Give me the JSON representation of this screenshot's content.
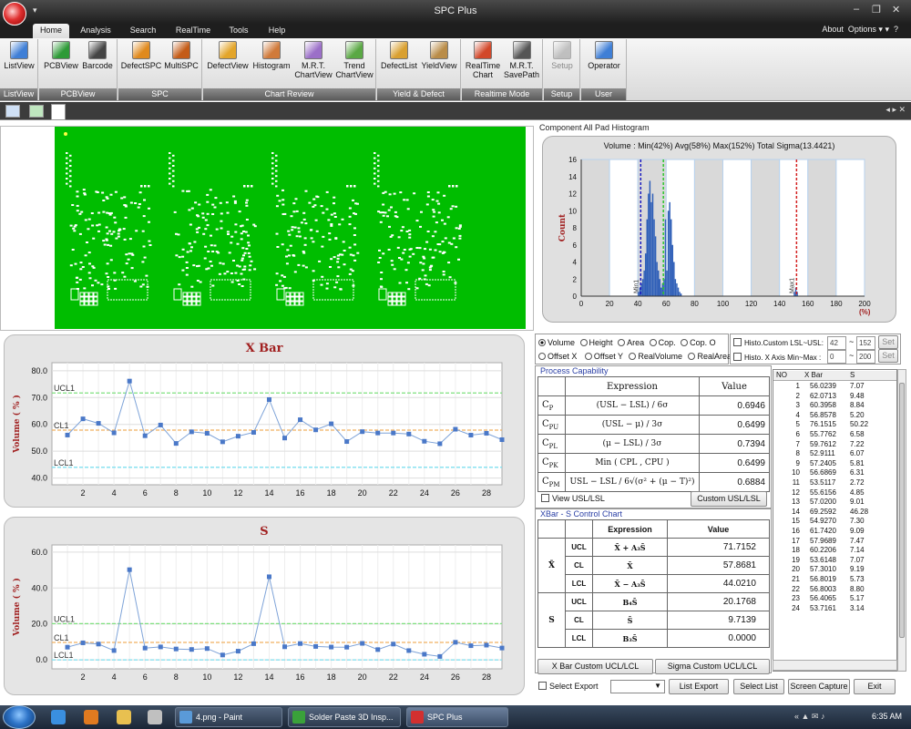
{
  "window": {
    "title": "SPC Plus",
    "controls": [
      "‒",
      "❐",
      "✕"
    ]
  },
  "ribbon_tabs": [
    {
      "label": "Home",
      "active": true
    },
    {
      "label": "Analysis"
    },
    {
      "label": "Search"
    },
    {
      "label": "RealTime"
    },
    {
      "label": "Tools"
    },
    {
      "label": "Help"
    }
  ],
  "top_right": {
    "about": "About",
    "options": "Options",
    "options_arrow": "▾ ▾",
    "help": "?"
  },
  "ribbon_groups": [
    {
      "label": "ListView",
      "buttons": [
        {
          "label": "ListView",
          "color": "#3f7fd6"
        }
      ]
    },
    {
      "label": "PCBView",
      "buttons": [
        {
          "label": "PCBView",
          "color": "#2e9a37"
        },
        {
          "label": "Barcode",
          "color": "#444444"
        }
      ]
    },
    {
      "label": "SPC",
      "buttons": [
        {
          "label": "DefectSPC",
          "color": "#e08a1e"
        },
        {
          "label": "MultiSPC",
          "color": "#c45c18"
        }
      ]
    },
    {
      "label": "Chart Review",
      "buttons": [
        {
          "label": "DefectView",
          "color": "#e3a52a"
        },
        {
          "label": "Histogram",
          "color": "#d07a3a"
        },
        {
          "label": "M.R.T. ChartView",
          "color": "#9b6fc8"
        },
        {
          "label": "Trend ChartView",
          "color": "#5aa844"
        }
      ]
    },
    {
      "label": "Yield & Defect",
      "buttons": [
        {
          "label": "DefectList",
          "color": "#d9a030"
        },
        {
          "label": "YieldView",
          "color": "#b98c48"
        }
      ]
    },
    {
      "label": "Realtime Mode",
      "buttons": [
        {
          "label": "RealTime Chart",
          "color": "#d2482a"
        },
        {
          "label": "M.R.T. SavePath",
          "color": "#555555"
        }
      ]
    },
    {
      "label": "Setup",
      "buttons": [
        {
          "label": "Setup",
          "color": "#999999",
          "disabled": true
        }
      ]
    },
    {
      "label": "User",
      "buttons": [
        {
          "label": "Operator",
          "color": "#3f7fd6"
        }
      ]
    }
  ],
  "doc_nav": "◂ ▸ ✕",
  "histogram": {
    "frame_title": "Component All Pad Histogram",
    "summary": "Volume : Min(42%) Avg(58%) Max(152%)  Total Sigma(13.4421)",
    "ylabel": "Count",
    "xunit": "(%)",
    "markers": {
      "min": "Min1",
      "max": "Max1"
    }
  },
  "chart_data": [
    {
      "type": "bar",
      "title": "",
      "xlabel": "(%)",
      "ylabel": "Count",
      "xlim": [
        0,
        200
      ],
      "ylim": [
        0,
        16
      ],
      "xticks": [
        0,
        20,
        40,
        60,
        80,
        100,
        120,
        140,
        160,
        180,
        200
      ],
      "yticks": [
        0,
        2,
        4,
        6,
        8,
        10,
        12,
        14,
        16
      ],
      "x": [
        40,
        41,
        42,
        43,
        44,
        45,
        46,
        47,
        48,
        49,
        50,
        51,
        52,
        53,
        54,
        55,
        56,
        57,
        58,
        59,
        60,
        61,
        62,
        63,
        64,
        65,
        66,
        67,
        68,
        69,
        70,
        150,
        151,
        152
      ],
      "values": [
        0.5,
        1,
        1.5,
        2,
        3,
        5,
        9,
        12,
        13.5,
        11,
        12,
        9,
        7,
        4,
        3,
        2,
        1,
        1.5,
        2,
        9,
        3,
        10,
        11,
        9,
        6,
        4,
        2,
        1.5,
        1,
        0.5,
        0.3,
        0.5,
        1,
        0.5
      ],
      "lines": [
        {
          "name": "Min1",
          "x": 42,
          "color": "#1a1ac0"
        },
        {
          "name": "Avg",
          "x": 58,
          "color": "#2ec72e"
        },
        {
          "name": "Max1",
          "x": 152,
          "color": "#d42020"
        }
      ]
    },
    {
      "type": "line",
      "title": "X Bar",
      "ylabel": "Volume ( % )",
      "xlim": [
        0,
        29
      ],
      "ylim": [
        37.5,
        83
      ],
      "yticks": [
        40.0,
        50.0,
        60.0,
        70.0,
        80.0
      ],
      "ytick_labels": [
        "40.0",
        "50.0",
        "60.0",
        "70.0",
        "80.0"
      ],
      "xticks": [
        2,
        4,
        6,
        8,
        10,
        12,
        14,
        16,
        18,
        20,
        22,
        24,
        26,
        28
      ],
      "x": [
        1,
        2,
        3,
        4,
        5,
        6,
        7,
        8,
        9,
        10,
        11,
        12,
        13,
        14,
        15,
        16,
        17,
        18,
        19,
        20,
        21,
        22,
        23,
        24,
        25,
        26,
        27,
        28,
        29
      ],
      "values": [
        56.0239,
        62.0713,
        60.3958,
        56.8578,
        76.1515,
        55.7762,
        59.7612,
        52.9111,
        57.2405,
        56.6869,
        53.5117,
        55.6156,
        57.02,
        69.2592,
        54.927,
        61.742,
        57.9689,
        60.2206,
        53.6148,
        57.301,
        56.8019,
        56.8003,
        56.4065,
        53.7161,
        52.8,
        58.2,
        56.0,
        56.7,
        54.3
      ],
      "limits": [
        {
          "name": "UCL1",
          "value": 71.7152,
          "color": "#7ee07e"
        },
        {
          "name": "CL1",
          "value": 57.8681,
          "color": "#f0b060"
        },
        {
          "name": "LCL1",
          "value": 44.021,
          "color": "#7fdfef"
        }
      ],
      "limit_labels": {
        "ucl": "UCL1",
        "cl": "CL1",
        "lcl": "LCL1"
      }
    },
    {
      "type": "line",
      "title": "S",
      "ylabel": "Volume ( % )",
      "xlim": [
        0,
        29
      ],
      "ylim": [
        -5,
        64
      ],
      "yticks": [
        0,
        20,
        40,
        60
      ],
      "ytick_labels": [
        "0.0",
        "20.0",
        "40.0",
        "60.0"
      ],
      "xticks": [
        2,
        4,
        6,
        8,
        10,
        12,
        14,
        16,
        18,
        20,
        22,
        24,
        26,
        28
      ],
      "x": [
        1,
        2,
        3,
        4,
        5,
        6,
        7,
        8,
        9,
        10,
        11,
        12,
        13,
        14,
        15,
        16,
        17,
        18,
        19,
        20,
        21,
        22,
        23,
        24,
        25,
        26,
        27,
        28,
        29
      ],
      "values": [
        7.07,
        9.48,
        8.8,
        5.2,
        50.22,
        6.58,
        7.22,
        6.07,
        5.81,
        6.31,
        2.72,
        4.85,
        9.01,
        46.28,
        7.3,
        9.09,
        7.47,
        7.14,
        7.07,
        9.19,
        5.73,
        8.8,
        5.17,
        3.14,
        1.9,
        9.8,
        7.9,
        8.2,
        6.6
      ],
      "limits": [
        {
          "name": "UCL1",
          "value": 20.1768,
          "color": "#7ee07e"
        },
        {
          "name": "CL1",
          "value": 9.7139,
          "color": "#f0b060"
        },
        {
          "name": "LCL1",
          "value": 0.0,
          "color": "#7fdfef"
        }
      ],
      "limit_labels": {
        "ucl": "UCL1",
        "cl": "CL1",
        "lcl": "LCL1"
      }
    }
  ],
  "measure_options": {
    "row1": [
      {
        "label": "Volume",
        "checked": true
      },
      {
        "label": "Height"
      },
      {
        "label": "Area"
      },
      {
        "label": "Cop."
      },
      {
        "label": "Cop. O"
      }
    ],
    "row2": [
      {
        "label": "Offset X"
      },
      {
        "label": "Offset Y"
      },
      {
        "label": "RealVolume"
      },
      {
        "label": "RealArea"
      }
    ]
  },
  "histo_settings": {
    "custom_lsl_usl_label": "Histo.Custom LSL~USL:",
    "lsl": "42",
    "usl": "152",
    "x_axis_label": "Histo. X Axis Min~Max :",
    "xmin": "0",
    "xmax": "200",
    "sep": "~",
    "set_label": "Set"
  },
  "process_capability": {
    "title": "Process Capability",
    "header_expr": "Expression",
    "header_value": "Value",
    "rows": [
      {
        "name": "C",
        "sub": "P",
        "expr": "(USL − LSL) / 6σ",
        "value": "0.6946"
      },
      {
        "name": "C",
        "sub": "PU",
        "expr": "(USL − μ) / 3σ",
        "value": "0.6499"
      },
      {
        "name": "C",
        "sub": "PL",
        "expr": "(μ − LSL) / 3σ",
        "value": "0.7394"
      },
      {
        "name": "C",
        "sub": "PK",
        "expr": "Min ( CPL , CPU )",
        "value": "0.6499"
      },
      {
        "name": "C",
        "sub": "PM",
        "expr": "USL − LSL / 6√(σ² + (μ − T)²)",
        "value": "0.6884"
      }
    ],
    "view_usl_lsl": "View USL/LSL",
    "custom_btn": "Custom USL/LSL"
  },
  "xs_control": {
    "title": "XBar - S Control Chart",
    "header_expr": "Expression",
    "header_value": "Value",
    "groups": [
      {
        "symbol": "X̄",
        "rows": [
          {
            "kind": "UCL",
            "expr": "X̄ + A₃S̄",
            "value": "71.7152"
          },
          {
            "kind": "CL",
            "expr": "X̄",
            "value": "57.8681"
          },
          {
            "kind": "LCL",
            "expr": "X̄ − A₃S̄",
            "value": "44.0210"
          }
        ]
      },
      {
        "symbol": "S",
        "rows": [
          {
            "kind": "UCL",
            "expr": "B₄S̄",
            "value": "20.1768"
          },
          {
            "kind": "CL",
            "expr": "S̄",
            "value": "9.7139"
          },
          {
            "kind": "LCL",
            "expr": "B₃S̄",
            "value": "0.0000"
          }
        ]
      }
    ],
    "btn_xbar": "X Bar Custom UCL/LCL",
    "btn_sigma": "Sigma Custom UCL/LCL"
  },
  "data_grid": {
    "headers": [
      "NO",
      "X Bar",
      "S"
    ],
    "rows": [
      [
        "1",
        "56.0239",
        "7.07"
      ],
      [
        "2",
        "62.0713",
        "9.48"
      ],
      [
        "3",
        "60.3958",
        "8.84"
      ],
      [
        "4",
        "56.8578",
        "5.20"
      ],
      [
        "5",
        "76.1515",
        "50.22"
      ],
      [
        "6",
        "55.7762",
        "6.58"
      ],
      [
        "7",
        "59.7612",
        "7.22"
      ],
      [
        "8",
        "52.9111",
        "6.07"
      ],
      [
        "9",
        "57.2405",
        "5.81"
      ],
      [
        "10",
        "56.6869",
        "6.31"
      ],
      [
        "11",
        "53.5117",
        "2.72"
      ],
      [
        "12",
        "55.6156",
        "4.85"
      ],
      [
        "13",
        "57.0200",
        "9.01"
      ],
      [
        "14",
        "69.2592",
        "46.28"
      ],
      [
        "15",
        "54.9270",
        "7.30"
      ],
      [
        "16",
        "61.7420",
        "9.09"
      ],
      [
        "17",
        "57.9689",
        "7.47"
      ],
      [
        "18",
        "60.2206",
        "7.14"
      ],
      [
        "19",
        "53.6148",
        "7.07"
      ],
      [
        "20",
        "57.3010",
        "9.19"
      ],
      [
        "21",
        "56.8019",
        "5.73"
      ],
      [
        "22",
        "56.8003",
        "8.80"
      ],
      [
        "23",
        "56.4065",
        "5.17"
      ],
      [
        "24",
        "53.7161",
        "3.14"
      ]
    ]
  },
  "footer": {
    "select_export": "Select Export",
    "list_export": "List Export",
    "select_list": "Select List",
    "screen_capture": "Screen Capture",
    "exit": "Exit"
  },
  "taskbar": {
    "tasks": [
      {
        "label": "4.png - Paint",
        "color": "#5a9ad8"
      },
      {
        "label": "Solder Paste 3D Insp...",
        "color": "#3aa13a"
      },
      {
        "label": "SPC Plus",
        "color": "#d23030"
      }
    ],
    "tray": "« ▲ ✉ ♪",
    "time": "6:35 AM"
  }
}
